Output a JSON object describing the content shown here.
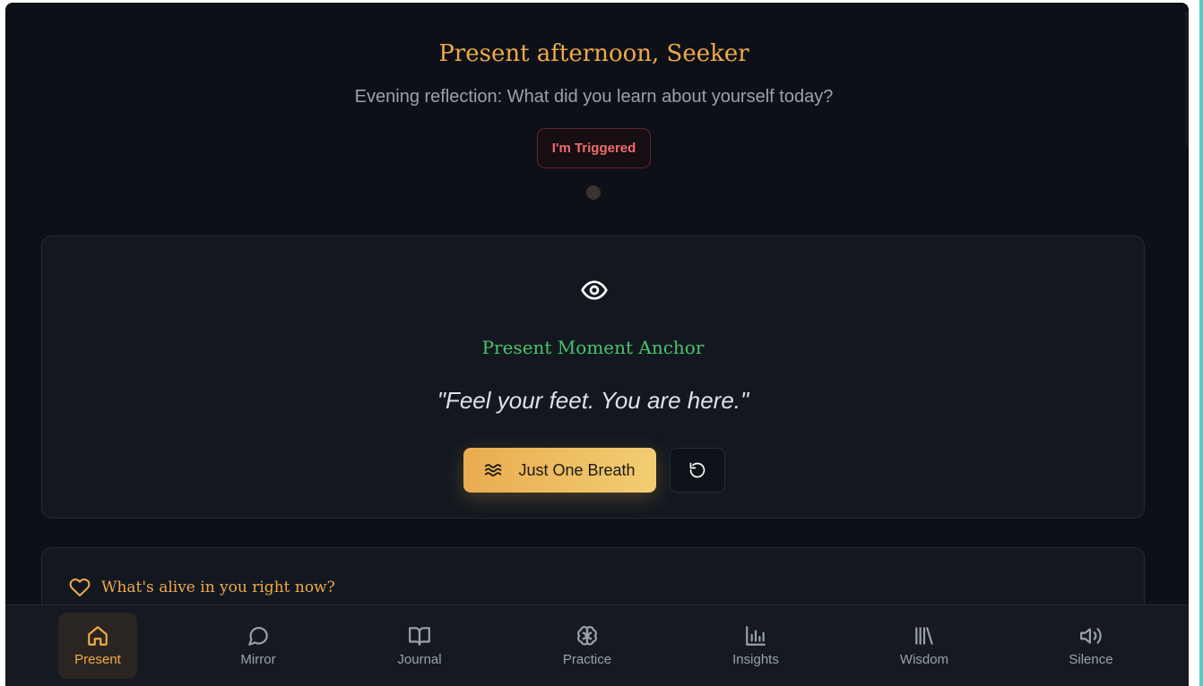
{
  "header": {
    "greeting": "Present afternoon, Seeker",
    "prompt": "Evening reflection: What did you learn about yourself today?",
    "trigger_label": "I'm Triggered"
  },
  "anchor": {
    "icon": "eye-icon",
    "title": "Present Moment Anchor",
    "quote": "\"Feel your feet. You are here.\"",
    "breath_label": "Just One Breath",
    "breath_icon": "waves-icon",
    "reset_icon": "rotate-ccw-icon"
  },
  "alive": {
    "icon": "heart-icon",
    "heading": "What's alive in you right now?"
  },
  "nav": {
    "items": [
      {
        "label": "Present",
        "icon": "home-icon",
        "active": true
      },
      {
        "label": "Mirror",
        "icon": "message-circle-icon",
        "active": false
      },
      {
        "label": "Journal",
        "icon": "book-open-icon",
        "active": false
      },
      {
        "label": "Practice",
        "icon": "brain-icon",
        "active": false
      },
      {
        "label": "Insights",
        "icon": "bar-chart-icon",
        "active": false
      },
      {
        "label": "Wisdom",
        "icon": "library-icon",
        "active": false
      },
      {
        "label": "Silence",
        "icon": "volume-icon",
        "active": false
      }
    ]
  },
  "colors": {
    "background": "#0d1117",
    "accent": "#f0a94a",
    "anchor_title": "#4cc36a",
    "trigger": "#f26b6b",
    "right_edge": "#4fd1c5"
  }
}
